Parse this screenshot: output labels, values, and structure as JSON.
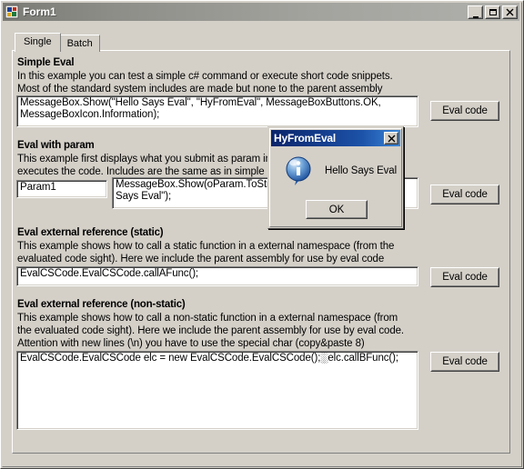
{
  "window": {
    "title": "Form1",
    "icon": "form-designer-icon",
    "controls": {
      "minimize": "minimize-icon",
      "maximize": "maximize-icon",
      "close": "close-icon"
    }
  },
  "tabs": [
    {
      "label": "Single",
      "active": true
    },
    {
      "label": "Batch",
      "active": false
    }
  ],
  "sections": [
    {
      "title": "Simple Eval",
      "description": [
        "In this example you can test a simple c# command or execute short code snippets.",
        "Most of the standard system includes are made but none to the parent assembly"
      ],
      "code": [
        "MessageBox.Show(\"Hello Says Eval\", \"HyFromEval\", MessageBoxButtons.OK,",
        "MessageBoxIcon.Information);"
      ],
      "button_label": "Eval code"
    },
    {
      "title": "Eval with param",
      "description": [
        "This example first displays what you submit as param in a textbox and then",
        "executes  the  code. Includes are the same as in simple eval"
      ],
      "param_value": "Param1",
      "code": [
        "MessageBox.Show(oParam.ToString() + \" Hello",
        "Says Eval\");"
      ],
      "button_label": "Eval code"
    },
    {
      "title": "Eval external reference (static)",
      "description": [
        "This example shows how to call a static function in a external namespace (from the",
        "evaluated code sight). Here we include the parent assembly for use by eval code"
      ],
      "code": [
        "EvalCSCode.EvalCSCode.callAFunc();"
      ],
      "button_label": "Eval code"
    },
    {
      "title": "Eval external reference (non-static)",
      "description": [
        "This example shows how to call a non-static function in a external namespace (from",
        "the evaluated code sight). Here we include the parent assembly for use by eval code.",
        "Attention with new lines (\\n) you have to use the special char (copy&paste 8)"
      ],
      "code": [
        "EvalCSCode.EvalCSCode elc = new EvalCSCode.EvalCSCode();░elc.callBFunc();"
      ],
      "button_label": "Eval code"
    }
  ],
  "dialog": {
    "title": "HyFromEval",
    "message": "Hello Says Eval",
    "icon": "information-icon",
    "close_label": "close-icon",
    "ok_label": "OK"
  },
  "colors": {
    "form_background": "#d4d0c8",
    "titlebar_gradient_start": "#7b7b76",
    "titlebar_gradient_end": "#b0b0ac",
    "dialog_titlebar_start": "#0a246a",
    "dialog_titlebar_end": "#3a86d8",
    "textbox_background": "#ffffff"
  }
}
